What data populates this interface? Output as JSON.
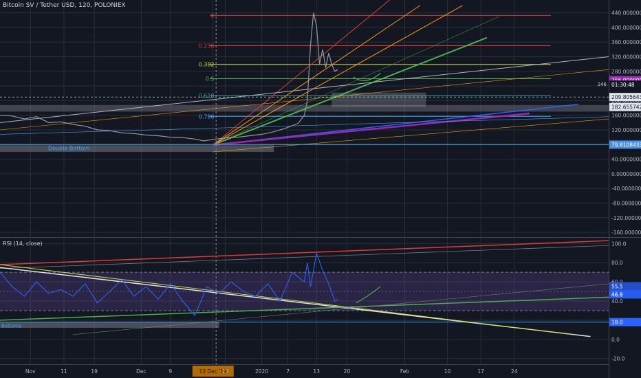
{
  "header": {
    "title": "Bitcoin SV / Tether USD, 120, POLONIEX",
    "rsi_title": "RSI (14, close)"
  },
  "chart_data": [
    {
      "type": "line",
      "name": "price",
      "y_ticks": [
        "440.00000000",
        "400.00000000",
        "360.00000000",
        "320.00000000",
        "280.00000000",
        "240.00000000",
        "200.00000000",
        "160.00000000",
        "120.00000000",
        "80.00000000",
        "40.00000000",
        "0.00000000",
        "-40.00000000",
        "-80.00000000",
        "-120.00000000",
        "-160.00000000"
      ],
      "y_tick_values": [
        440,
        400,
        360,
        320,
        280,
        240,
        200,
        160,
        120,
        80,
        40,
        0,
        -40,
        -80,
        -120,
        -160
      ],
      "ylim": [
        -173,
        475
      ],
      "x_ticks": [
        "Nov",
        "11",
        "19",
        "Dec",
        "9",
        "13 Dec '19",
        "23",
        "2020",
        "7",
        "13",
        "20",
        "Feb",
        "10",
        "17",
        "24"
      ],
      "x_tick_pos": [
        0.05,
        0.105,
        0.155,
        0.232,
        0.28,
        0.35,
        0.37,
        0.43,
        0.473,
        0.52,
        0.57,
        0.665,
        0.735,
        0.79,
        0.845
      ],
      "price_labels": [
        {
          "text": "256.00000013",
          "value": 256,
          "color": "#9c27b0"
        },
        {
          "text": "01:30:48",
          "value": 244,
          "color": "#131722"
        },
        {
          "text": "209.80564314",
          "value": 209.8,
          "color": "#e0e3eb"
        },
        {
          "text": "182.65574274",
          "value": 182.6,
          "color": "#e0e3eb"
        },
        {
          "text": "79.81084335",
          "value": 79.8,
          "color": "#4a90e2"
        }
      ],
      "fib_levels": [
        {
          "label": "0",
          "value": 433,
          "color": "#e53935"
        },
        {
          "label": "0.236",
          "value": 350,
          "color": "#e53935"
        },
        {
          "label": "0.382",
          "value": 299,
          "color": "#cddc39"
        },
        {
          "label": "0.5",
          "value": 260,
          "color": "#4caf50"
        },
        {
          "label": "0.618",
          "value": 214,
          "color": "#26a69a"
        },
        {
          "label": "0.786",
          "value": 157,
          "color": "#42a5f5"
        }
      ],
      "fib_extra_labels": [
        "246"
      ],
      "annotations": [
        "Double Bottom"
      ],
      "series": [
        {
          "x": [
            0.0,
            0.02,
            0.04,
            0.06,
            0.08,
            0.1,
            0.12,
            0.14,
            0.16,
            0.18,
            0.2,
            0.22,
            0.24,
            0.26,
            0.28,
            0.3,
            0.32,
            0.335,
            0.35,
            0.37,
            0.39,
            0.41,
            0.43,
            0.45,
            0.47,
            0.49,
            0.5,
            0.505,
            0.51,
            0.515,
            0.52,
            0.525,
            0.53,
            0.535,
            0.54,
            0.545,
            0.55,
            0.555
          ],
          "y": [
            160,
            158,
            150,
            156,
            140,
            142,
            135,
            130,
            120,
            118,
            112,
            110,
            106,
            104,
            100,
            99,
            95,
            90,
            94,
            98,
            100,
            104,
            108,
            115,
            125,
            138,
            160,
            200,
            350,
            440,
            405,
            300,
            340,
            290,
            330,
            300,
            280,
            285
          ]
        }
      ]
    },
    {
      "type": "line",
      "name": "rsi",
      "y_ticks": [
        "100.0",
        "80.0",
        "60.0",
        "40.0",
        "20.0",
        "0.0",
        "-20.0"
      ],
      "y_tick_values": [
        100,
        80,
        60,
        40,
        20,
        0,
        -20
      ],
      "ylim": [
        -26,
        106
      ],
      "value_labels": [
        {
          "text": "55.5",
          "value": 55.5
        },
        {
          "text": "47.4",
          "value": 47.4
        },
        {
          "text": "46.8",
          "value": 46.8
        },
        {
          "text": "18.0",
          "value": 18
        }
      ],
      "band": [
        30,
        70
      ],
      "annotations": [
        "Bottoms"
      ],
      "series": [
        {
          "x": [
            0.0,
            0.02,
            0.04,
            0.06,
            0.08,
            0.1,
            0.12,
            0.14,
            0.16,
            0.18,
            0.2,
            0.22,
            0.24,
            0.26,
            0.28,
            0.3,
            0.32,
            0.34,
            0.36,
            0.38,
            0.4,
            0.42,
            0.44,
            0.46,
            0.48,
            0.5,
            0.505,
            0.51,
            0.52,
            0.53,
            0.54,
            0.55,
            0.555
          ],
          "y": [
            70,
            55,
            45,
            60,
            48,
            52,
            45,
            58,
            38,
            50,
            62,
            45,
            55,
            42,
            58,
            40,
            25,
            55,
            48,
            60,
            50,
            45,
            58,
            40,
            70,
            60,
            80,
            55,
            90,
            72,
            58,
            40,
            42
          ]
        }
      ]
    }
  ],
  "colors": {
    "bg": "#131722",
    "grid": "#2a2e39",
    "text": "#b2b5be",
    "price": "#9598a1",
    "rsi": "#2962ff",
    "red": "#e53935",
    "orange": "#ff9800",
    "green": "#4caf50",
    "blue": "#2962ff",
    "purple": "#9c27b0",
    "gray": "#787b86"
  }
}
